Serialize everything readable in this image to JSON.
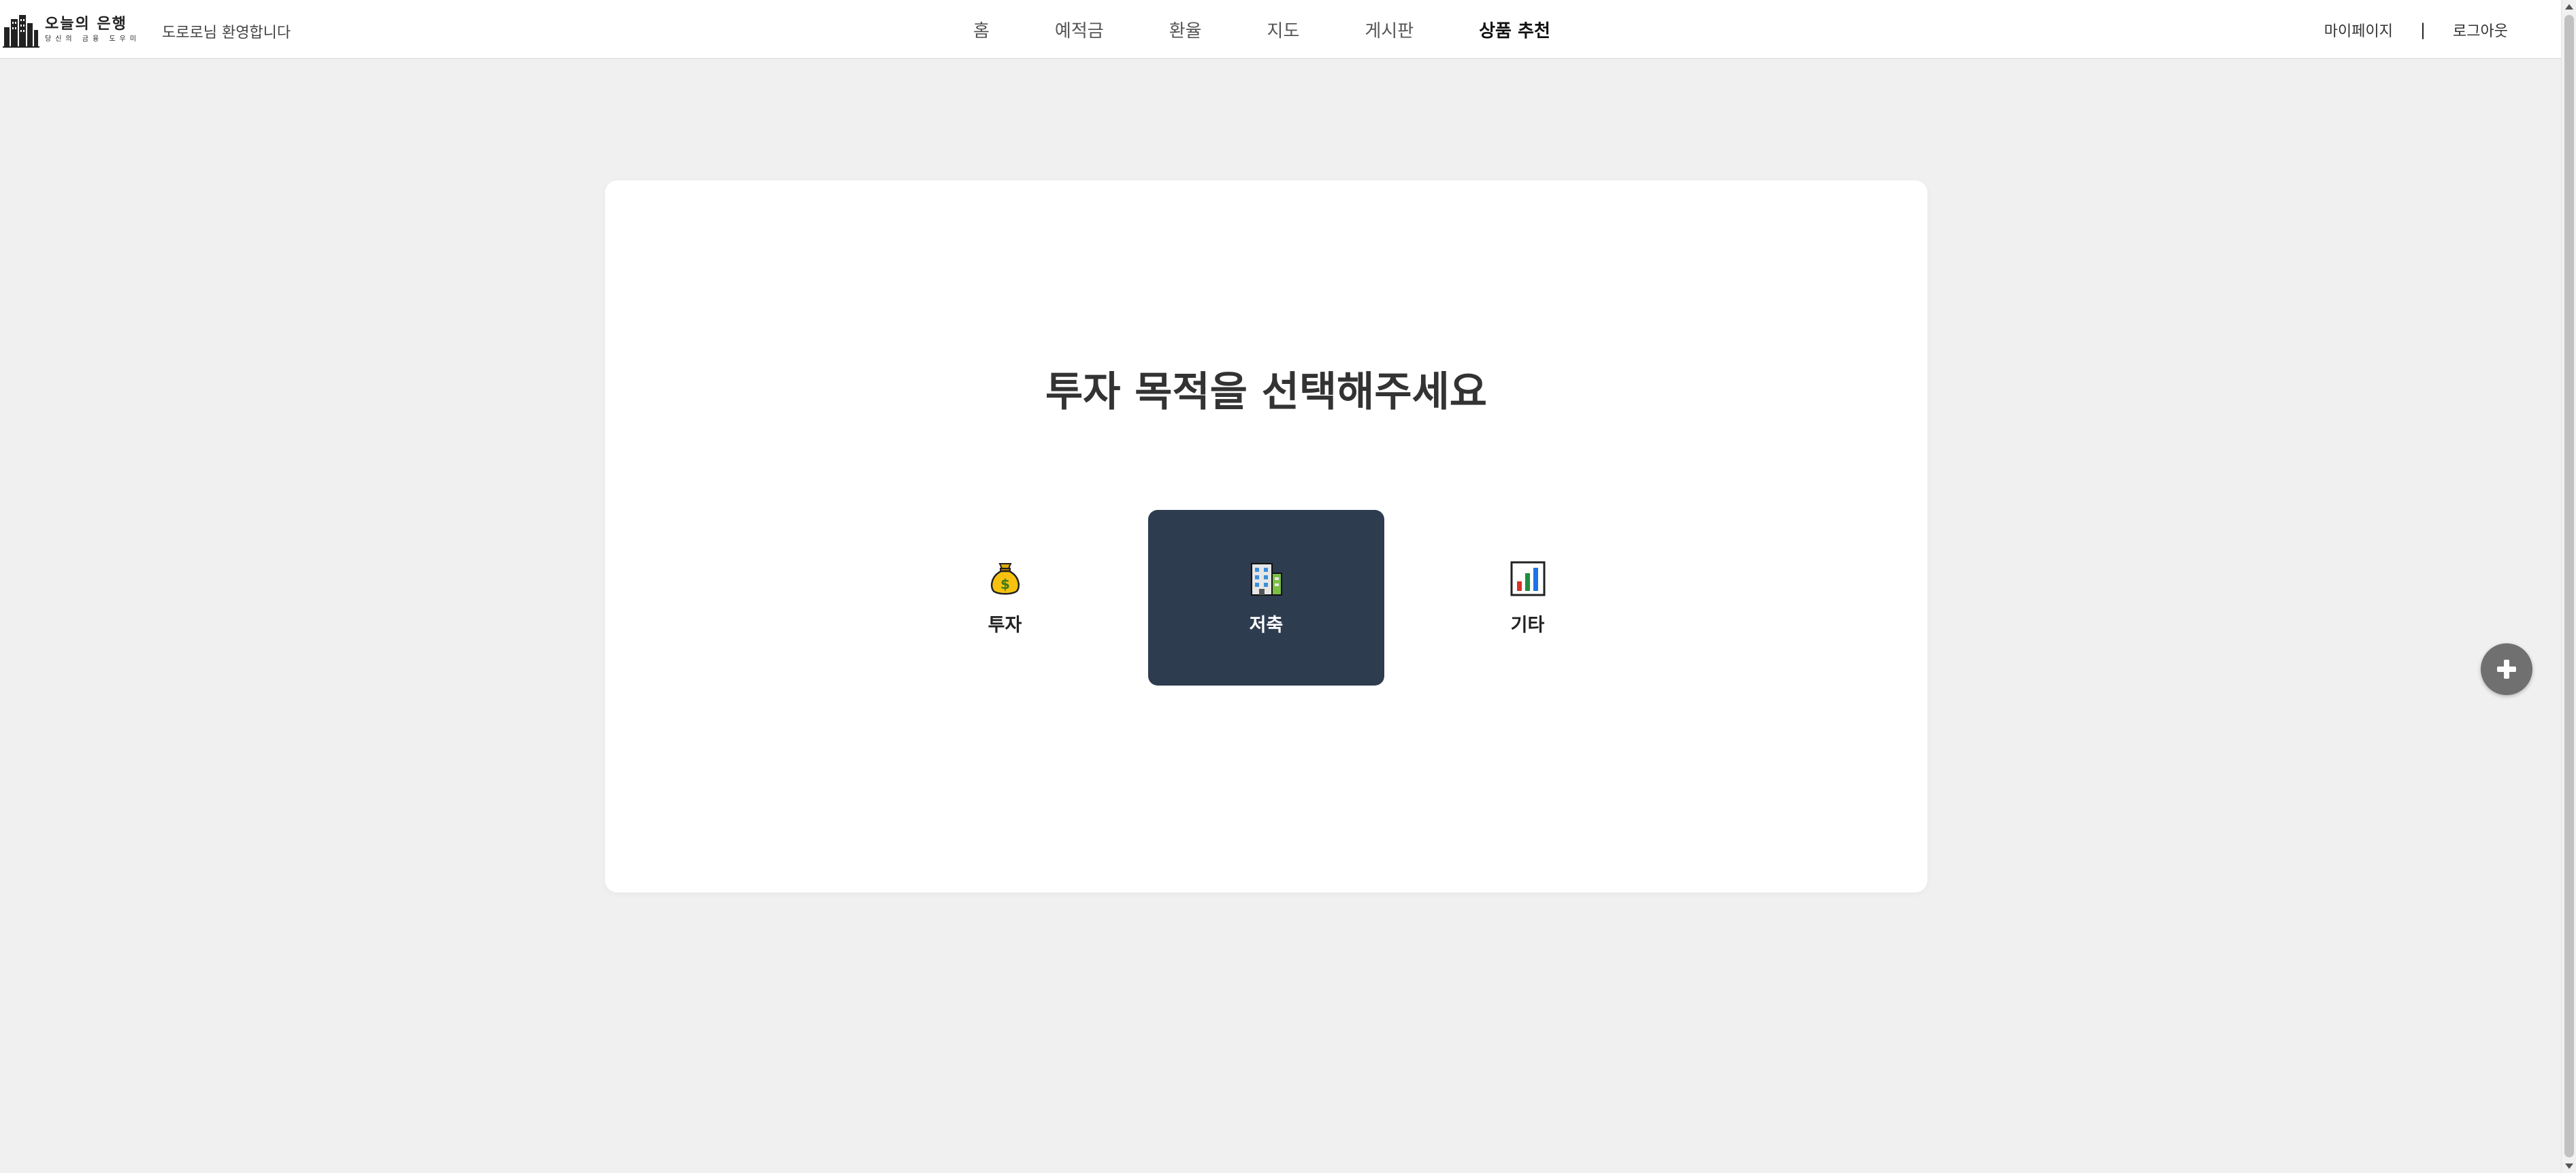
{
  "header": {
    "logo": {
      "title": "오늘의 은행",
      "subtitle": "당신의 금융 도우미",
      "icon": "city-buildings-icon"
    },
    "welcome_text": "도로로님 환영합니다",
    "nav": [
      {
        "label": "홈",
        "active": false
      },
      {
        "label": "예적금",
        "active": false
      },
      {
        "label": "환율",
        "active": false
      },
      {
        "label": "지도",
        "active": false
      },
      {
        "label": "게시판",
        "active": false
      },
      {
        "label": "상품 추천",
        "active": true
      }
    ],
    "user_menu": {
      "mypage": "마이페이지",
      "separator": "|",
      "logout": "로그아웃"
    }
  },
  "main": {
    "title": "투자 목적을 선택해주세요",
    "options": [
      {
        "label": "투자",
        "icon": "money-bag-icon",
        "selected": false
      },
      {
        "label": "저축",
        "icon": "office-building-icon",
        "selected": true
      },
      {
        "label": "기타",
        "icon": "bar-chart-icon",
        "selected": false
      }
    ]
  },
  "fab": {
    "icon": "plus-icon"
  },
  "colors": {
    "background": "#f0f0f0",
    "card": "#ffffff",
    "selected_option": "#2e3c4f",
    "fab": "#707070"
  }
}
